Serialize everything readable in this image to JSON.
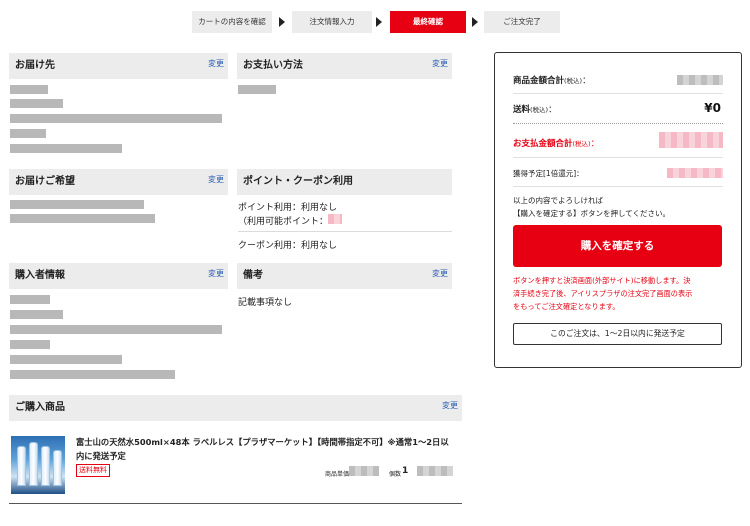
{
  "steps": [
    "カートの内容を確認",
    "注文情報入力",
    "最終確認",
    "ご注文完了"
  ],
  "active_step": 2,
  "sections": {
    "delivery": {
      "title": "お届け先",
      "edit": "変更"
    },
    "payment": {
      "title": "お支払い方法",
      "edit": "変更"
    },
    "delivery_pref": {
      "title": "お届けご希望",
      "edit": "変更"
    },
    "points": {
      "title": "ポイント・クーポン利用"
    },
    "buyer": {
      "title": "購入者情報",
      "edit": "変更"
    },
    "remarks": {
      "title": "備考",
      "edit": "変更"
    },
    "items": {
      "title": "ご購入商品",
      "edit": "変更"
    }
  },
  "points": {
    "point_use": "ポイント利用：利用なし",
    "available": "（利用可能ポイント：",
    "coupon_use": "クーポン利用：利用なし"
  },
  "remarks": {
    "text": "記載事項なし"
  },
  "summary": {
    "subtotal_label": "商品金額合計",
    "tax_note": "(税込)",
    "shipping_label": "送料",
    "shipping_value": "¥0",
    "total_label": "お支払金額合計",
    "points_label": "獲得予定[1倍還元]：",
    "note_line1": "以上の内容でよろしければ",
    "note_line2": "【購入を確定する】ボタンを押してください。",
    "confirm_button": "購入を確定する",
    "warning_line1": "ボタンを押すと決済画面(外部サイト)に移動します。決",
    "warning_line2": "済手続き完了後、アイリスプラザの注文完了画面の表示",
    "warning_line3": "をもってご注文確定となります。",
    "ship_estimate": "このご注文は、1〜2日以内に発送予定"
  },
  "product": {
    "name_line1": "富士山の天然水500ml×48本 ラベルレス【プラザマーケット】【時間帯指定不可】※通常1〜2日以",
    "name_line2": "内に発送予定",
    "free_shipping_tag": "送料無料",
    "unit_price_label": "商品単価",
    "quantity_label": "個数",
    "quantity": "1"
  },
  "colors": {
    "accent": "#e60012",
    "link": "#2a5db0",
    "header_bg": "#ececec"
  }
}
